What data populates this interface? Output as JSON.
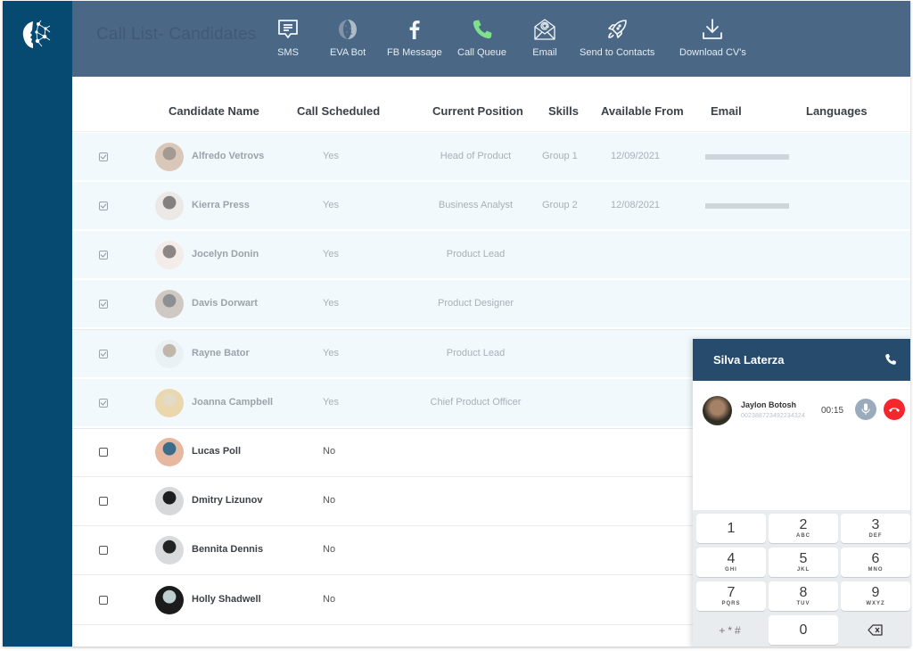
{
  "header": {
    "title": "Call List- Candidates",
    "toolbar": [
      {
        "label": "SMS",
        "icon": "sms-icon"
      },
      {
        "label": "EVA Bot",
        "icon": "eva-bot-icon"
      },
      {
        "label": "FB Message",
        "icon": "facebook-icon"
      },
      {
        "label": "Call Queue",
        "icon": "phone-icon"
      },
      {
        "label": "Email",
        "icon": "email-icon"
      },
      {
        "label": "Send to Contacts",
        "icon": "rocket-icon"
      },
      {
        "label": "Download CV's",
        "icon": "download-icon"
      }
    ]
  },
  "colors": {
    "sidebar": "#064a72",
    "header": "#4a6785",
    "call_queue_accent": "#7ee08c",
    "dialer_header": "#274b6d",
    "hangup": "#f3272c",
    "selected_row": "#f1f9fd"
  },
  "table": {
    "columns": [
      "Candidate Name",
      "Call Scheduled",
      "Current Position",
      "Skills",
      "Available From",
      "Email",
      "Languages"
    ],
    "rows": [
      {
        "selected": true,
        "name": "Alfredo Vetrovs",
        "scheduled": "Yes",
        "position": "Head of Product",
        "skills": "Group 1",
        "available": "12/09/2021",
        "email_redacted": true
      },
      {
        "selected": true,
        "name": "Kierra Press",
        "scheduled": "Yes",
        "position": "Business Analyst",
        "skills": "Group 2",
        "available": "12/08/2021",
        "email_redacted": true
      },
      {
        "selected": true,
        "name": "Jocelyn Donin",
        "scheduled": "Yes",
        "position": "Product Lead",
        "skills": "",
        "available": "",
        "email_redacted": false
      },
      {
        "selected": true,
        "name": "Davis Dorwart",
        "scheduled": "Yes",
        "position": "Product Designer",
        "skills": "",
        "available": "",
        "email_redacted": false
      },
      {
        "selected": true,
        "name": "Rayne Bator",
        "scheduled": "Yes",
        "position": "Product Lead",
        "skills": "",
        "available": "",
        "email_redacted": false
      },
      {
        "selected": true,
        "name": "Joanna Campbell",
        "scheduled": "Yes",
        "position": "Chief Product Officer",
        "skills": "",
        "available": "",
        "email_redacted": false
      },
      {
        "selected": false,
        "name": "Lucas Poll",
        "scheduled": "No",
        "position": "",
        "skills": "",
        "available": "",
        "email_redacted": false
      },
      {
        "selected": false,
        "name": "Dmitry Lizunov",
        "scheduled": "No",
        "position": "",
        "skills": "",
        "available": "",
        "email_redacted": false
      },
      {
        "selected": false,
        "name": "Bennita Dennis",
        "scheduled": "No",
        "position": "",
        "skills": "",
        "available": "",
        "email_redacted": false
      },
      {
        "selected": false,
        "name": "Holly Shadwell",
        "scheduled": "No",
        "position": "",
        "skills": "",
        "available": "",
        "email_redacted": false
      }
    ]
  },
  "dialer": {
    "title": "Silva Laterza",
    "call": {
      "caller_name": "Jaylon Botosh",
      "caller_number": "002388723492234324",
      "timer": "00:15"
    },
    "keys": [
      {
        "num": "1",
        "letters": ""
      },
      {
        "num": "2",
        "letters": "ABC"
      },
      {
        "num": "3",
        "letters": "DEF"
      },
      {
        "num": "4",
        "letters": "GHI"
      },
      {
        "num": "5",
        "letters": "JKL"
      },
      {
        "num": "6",
        "letters": "MNO"
      },
      {
        "num": "7",
        "letters": "PQRS"
      },
      {
        "num": "8",
        "letters": "TUV"
      },
      {
        "num": "9",
        "letters": "WXYZ"
      },
      {
        "num": "+*#",
        "letters": ""
      },
      {
        "num": "0",
        "letters": ""
      },
      {
        "num": "backspace",
        "letters": ""
      }
    ]
  }
}
